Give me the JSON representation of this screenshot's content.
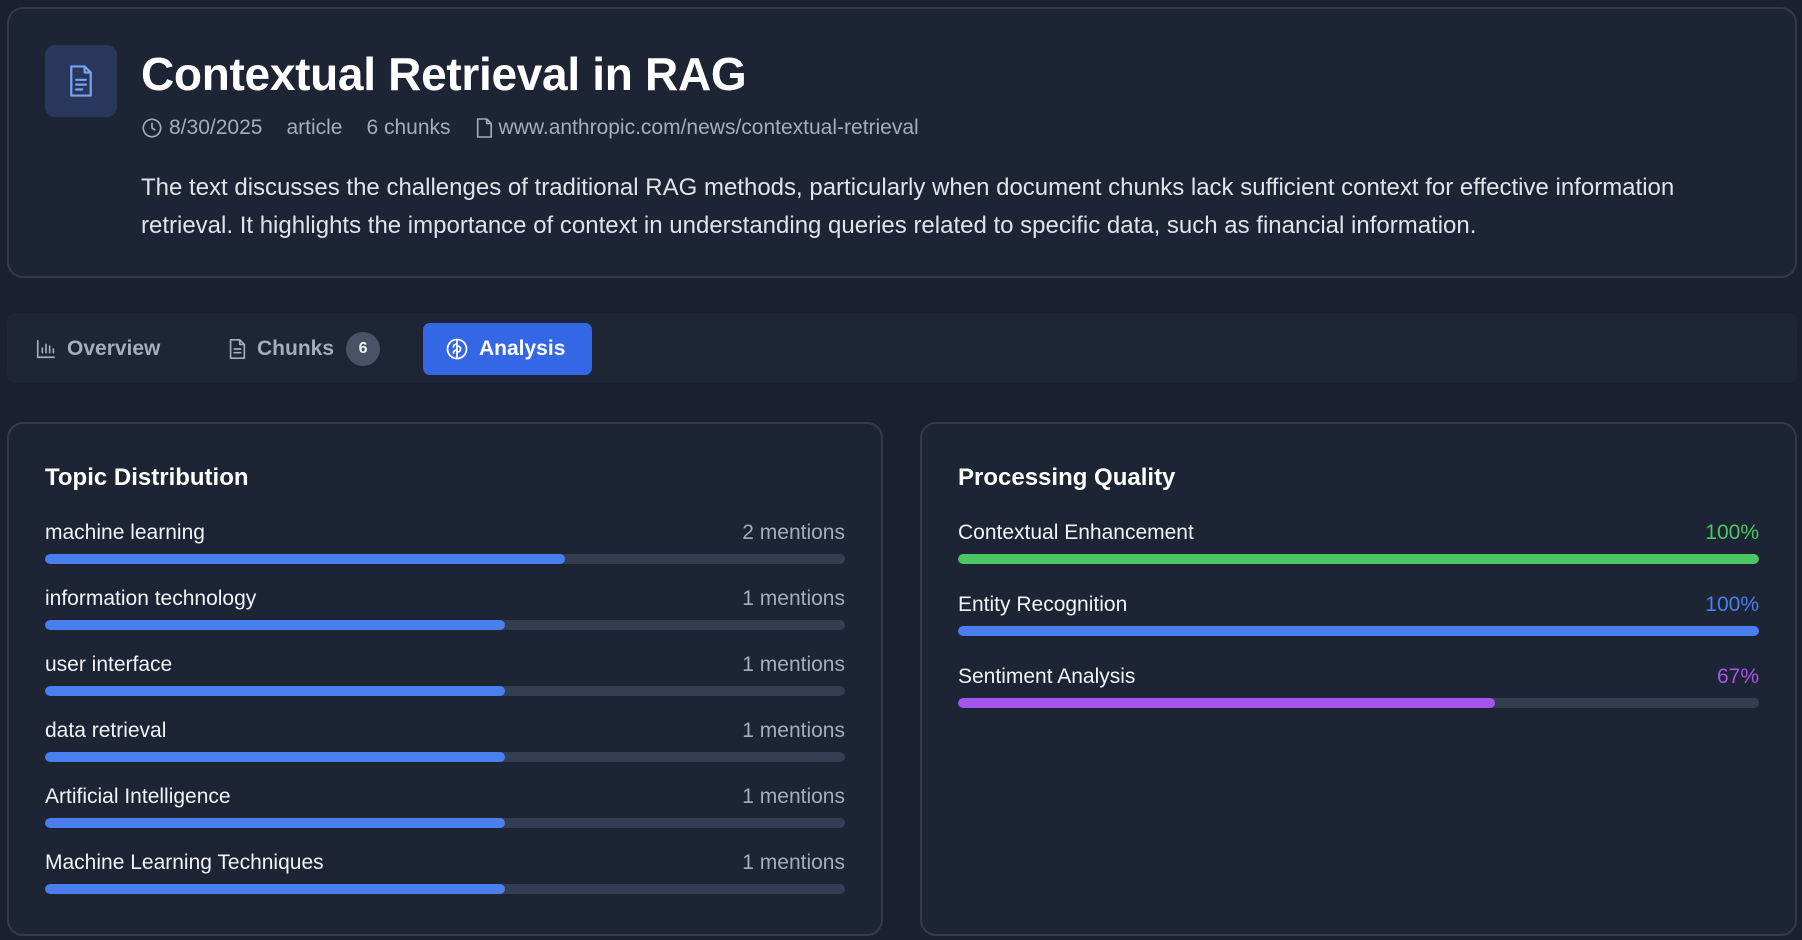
{
  "document": {
    "title": "Contextual Retrieval in RAG",
    "date": "8/30/2025",
    "type": "article",
    "chunk_count": "6 chunks",
    "source_url": "www.anthropic.com/news/contextual-retrieval",
    "summary": "The text discusses the challenges of traditional RAG methods, particularly when document chunks lack sufficient context for effective information retrieval. It highlights the importance of context in understanding queries related to specific data, such as financial information.",
    "icon": "document-icon"
  },
  "tabs": [
    {
      "label": "Overview",
      "icon": "bar-chart-icon",
      "active": false
    },
    {
      "label": "Chunks",
      "icon": "document-icon",
      "badge": "6",
      "active": false
    },
    {
      "label": "Analysis",
      "icon": "brain-icon",
      "active": true
    }
  ],
  "topic_distribution": {
    "title": "Topic Distribution",
    "bar_color": "#4a7ff0",
    "items": [
      {
        "label": "machine learning",
        "value": "2 mentions",
        "fill": 0.65
      },
      {
        "label": "information technology",
        "value": "1 mentions",
        "fill": 0.575
      },
      {
        "label": "user interface",
        "value": "1 mentions",
        "fill": 0.575
      },
      {
        "label": "data retrieval",
        "value": "1 mentions",
        "fill": 0.575
      },
      {
        "label": "Artificial Intelligence",
        "value": "1 mentions",
        "fill": 0.575
      },
      {
        "label": "Machine Learning Techniques",
        "value": "1 mentions",
        "fill": 0.575
      }
    ]
  },
  "processing_quality": {
    "title": "Processing Quality",
    "items": [
      {
        "label": "Contextual Enhancement",
        "value": "100%",
        "fill": 1.0,
        "color": "#4cc563"
      },
      {
        "label": "Entity Recognition",
        "value": "100%",
        "fill": 1.0,
        "color": "#4a7ff0"
      },
      {
        "label": "Sentiment Analysis",
        "value": "67%",
        "fill": 0.67,
        "color": "#a455ec"
      }
    ]
  },
  "colors": {
    "background": "#1a2030",
    "card": "#1d2434",
    "accent": "#3467e5",
    "muted_text": "#a5adbc"
  }
}
